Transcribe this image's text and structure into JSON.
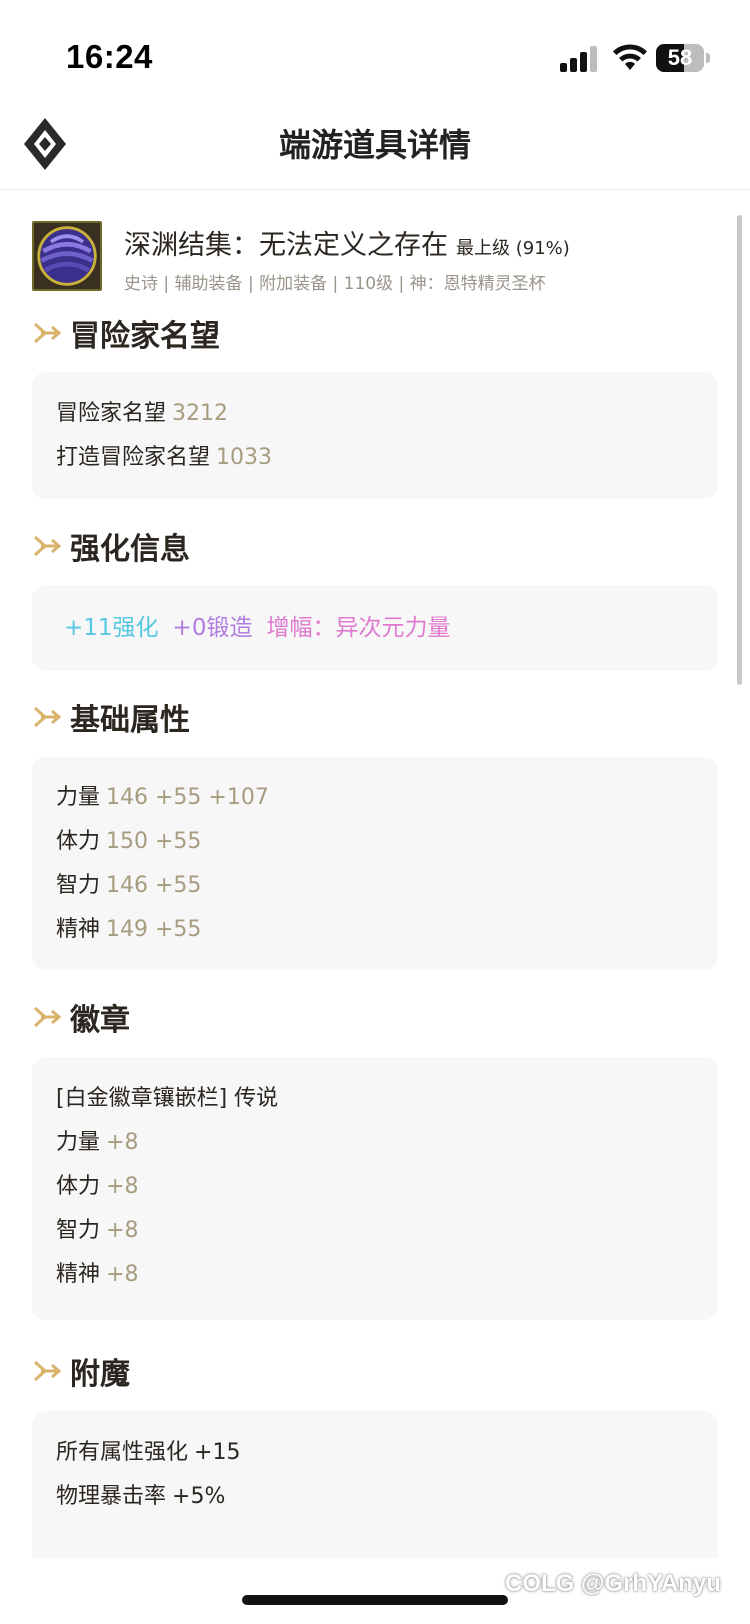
{
  "status_bar": {
    "time": "16:24",
    "battery": "58",
    "battery_level": 0.58
  },
  "nav": {
    "title": "端游道具详情"
  },
  "item": {
    "name": "深渊结集：无法定义之存在",
    "level": "最上级 (91%)",
    "tags": [
      "史诗",
      "辅助装备",
      "附加装备",
      "110级",
      "神：恩特精灵圣杯"
    ]
  },
  "sections": {
    "reputation": {
      "title": "冒险家名望",
      "rows": [
        {
          "label": "冒险家名望",
          "value": "3212"
        },
        {
          "label": "打造冒险家名望",
          "value": "1033"
        }
      ]
    },
    "enhance": {
      "title": "强化信息",
      "reinforce": "+11强化",
      "forge": "+0锻造",
      "amplify": "增幅：异次元力量",
      "colors": {
        "reinforce": "#56c8e4",
        "forge": "#b07ce0",
        "amplify": "#e07ad0"
      }
    },
    "base_stats": {
      "title": "基础属性",
      "rows": [
        {
          "label": "力量",
          "value": "146 +55 +107"
        },
        {
          "label": "体力",
          "value": "150 +55"
        },
        {
          "label": "智力",
          "value": "146 +55"
        },
        {
          "label": "精神",
          "value": "149 +55"
        }
      ]
    },
    "emblem": {
      "title": "徽章",
      "slot": "[白金徽章镶嵌栏] 传说",
      "rows": [
        {
          "label": "力量",
          "value": "+8"
        },
        {
          "label": "体力",
          "value": "+8"
        },
        {
          "label": "智力",
          "value": "+8"
        },
        {
          "label": "精神",
          "value": "+8"
        }
      ]
    },
    "enchant": {
      "title": "附魔",
      "rows": [
        {
          "label": "所有属性强化",
          "value": "+15"
        },
        {
          "label": "物理暴击率",
          "value": "+5%"
        }
      ]
    }
  },
  "watermark": "COLG @GrhYAnyu",
  "icons": {
    "logo": "diamond-logo-icon",
    "section": "double-chevron-arrow-icon",
    "item": "abyss-orb-item-icon"
  }
}
